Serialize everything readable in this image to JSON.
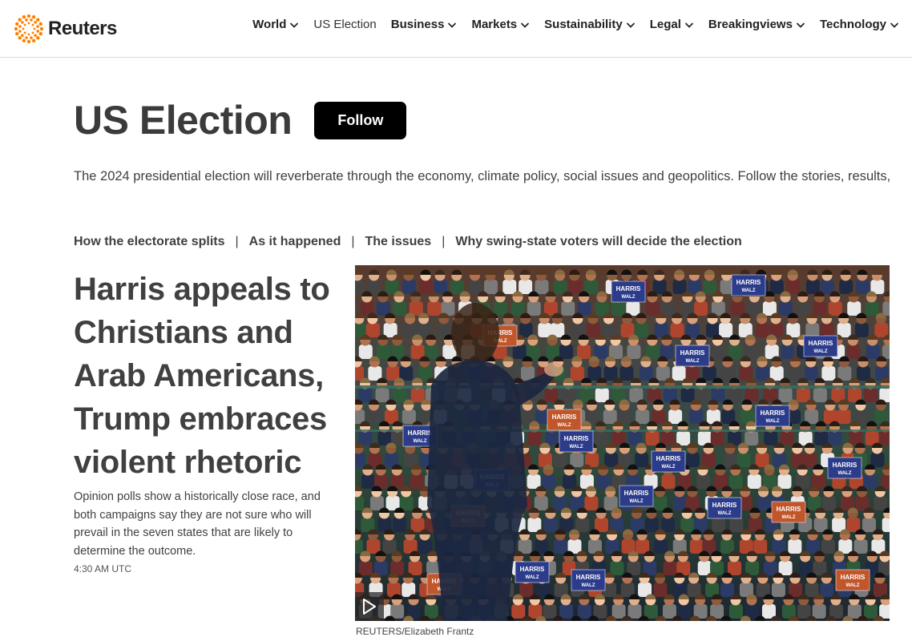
{
  "brand": {
    "name": "Reuters",
    "accent": "#ff8000"
  },
  "nav": {
    "items": [
      {
        "label": "World",
        "dropdown": true
      },
      {
        "label": "US Election",
        "dropdown": false
      },
      {
        "label": "Business",
        "dropdown": true
      },
      {
        "label": "Markets",
        "dropdown": true
      },
      {
        "label": "Sustainability",
        "dropdown": true
      },
      {
        "label": "Legal",
        "dropdown": true
      },
      {
        "label": "Breakingviews",
        "dropdown": true
      },
      {
        "label": "Technology",
        "dropdown": true
      }
    ]
  },
  "page": {
    "title": "US Election",
    "follow_label": "Follow",
    "description": "The 2024 presidential election will reverberate through the economy, climate policy, social issues and geopolitics. Follow the stories, results,"
  },
  "subnav": {
    "links": [
      "How the electorate splits",
      "As it happened",
      "The issues",
      "Why swing-state voters will decide the election"
    ]
  },
  "lead": {
    "headline": "Harris appeals to Christians and Arab Americans, Trump embraces violent rhetoric",
    "summary": "Opinion polls show a historically close race, and both campaigns say they are not sure who will prevail in the seven states that are likely to determine the outcome.",
    "timestamp": "4:30 AM UTC",
    "photo_caption": "REUTERS/Elizabeth Frantz",
    "photo_sign_text_1": "HARRIS",
    "photo_sign_text_2": "WALZ"
  }
}
